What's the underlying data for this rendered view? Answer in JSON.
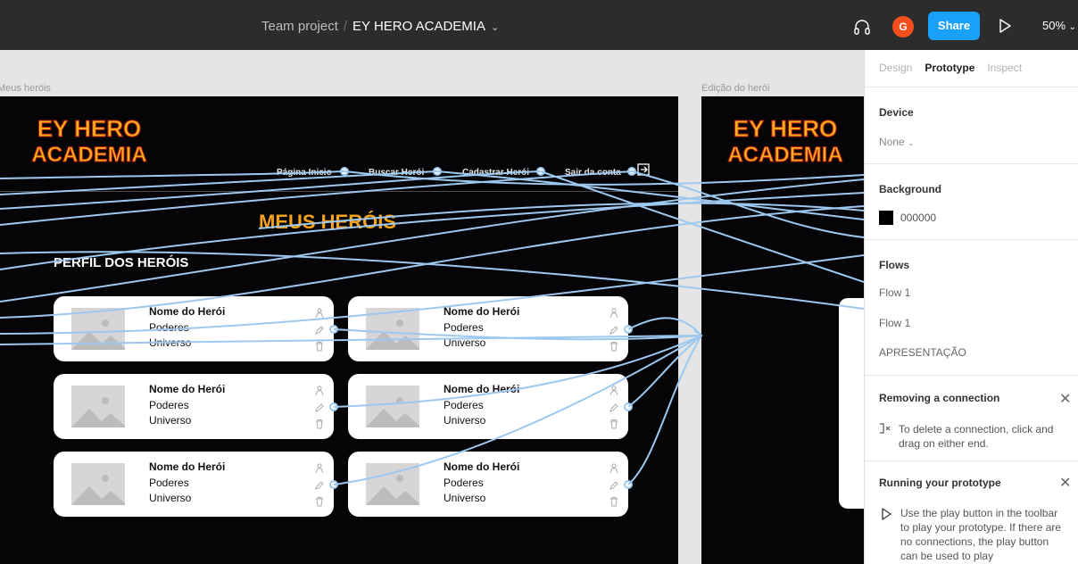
{
  "toolbar": {
    "project": "Team project",
    "separator": "/",
    "file_name": "EY HERO ACADEMIA",
    "avatar_initial": "G",
    "share_label": "Share",
    "zoom": "50%"
  },
  "canvas": {
    "frames": [
      {
        "label": "Meus heróis",
        "logo": {
          "line1": "EY HERO",
          "line2": "ACADEMIA"
        },
        "nav": [
          "Página Inicio",
          "Buscar Herói",
          "Cadastrar Herói",
          "Sair da conta"
        ],
        "title": "MEUS HERÓIS",
        "section": "PERFIL DOS HERÓIS",
        "cards": [
          {
            "name": "Nome do Herói",
            "powers": "Poderes",
            "universe": "Universo"
          },
          {
            "name": "Nome do Herói",
            "powers": "Poderes",
            "universe": "Universo"
          },
          {
            "name": "Nome do Herói",
            "powers": "Poderes",
            "universe": "Universo"
          },
          {
            "name": "Nome do Herói",
            "powers": "Poderes",
            "universe": "Universo"
          },
          {
            "name": "Nome do Herói",
            "powers": "Poderes",
            "universe": "Universo"
          },
          {
            "name": "Nome do Herói",
            "powers": "Poderes",
            "universe": "Universo"
          }
        ]
      },
      {
        "label": "Edição do herói",
        "logo": {
          "line1": "EY HERO",
          "line2": "ACADEMIA"
        }
      }
    ],
    "wire_color": "#9dc8f0",
    "accent_title_color": "#f7a21b"
  },
  "panel": {
    "tabs": [
      "Design",
      "Prototype",
      "Inspect"
    ],
    "active_tab": "Prototype",
    "device": {
      "title": "Device",
      "value": "None"
    },
    "background": {
      "title": "Background",
      "value": "000000",
      "color": "#000000"
    },
    "flows": {
      "title": "Flows",
      "items": [
        "Flow 1",
        "Flow 1",
        "APRESENTAÇÃO"
      ]
    },
    "removing": {
      "title": "Removing a connection",
      "text": "To delete a connection, click and drag on either end."
    },
    "running": {
      "title": "Running your prototype",
      "text": "Use the play button in the toolbar to play your prototype. If there are no connections, the play button can be used to play"
    }
  }
}
